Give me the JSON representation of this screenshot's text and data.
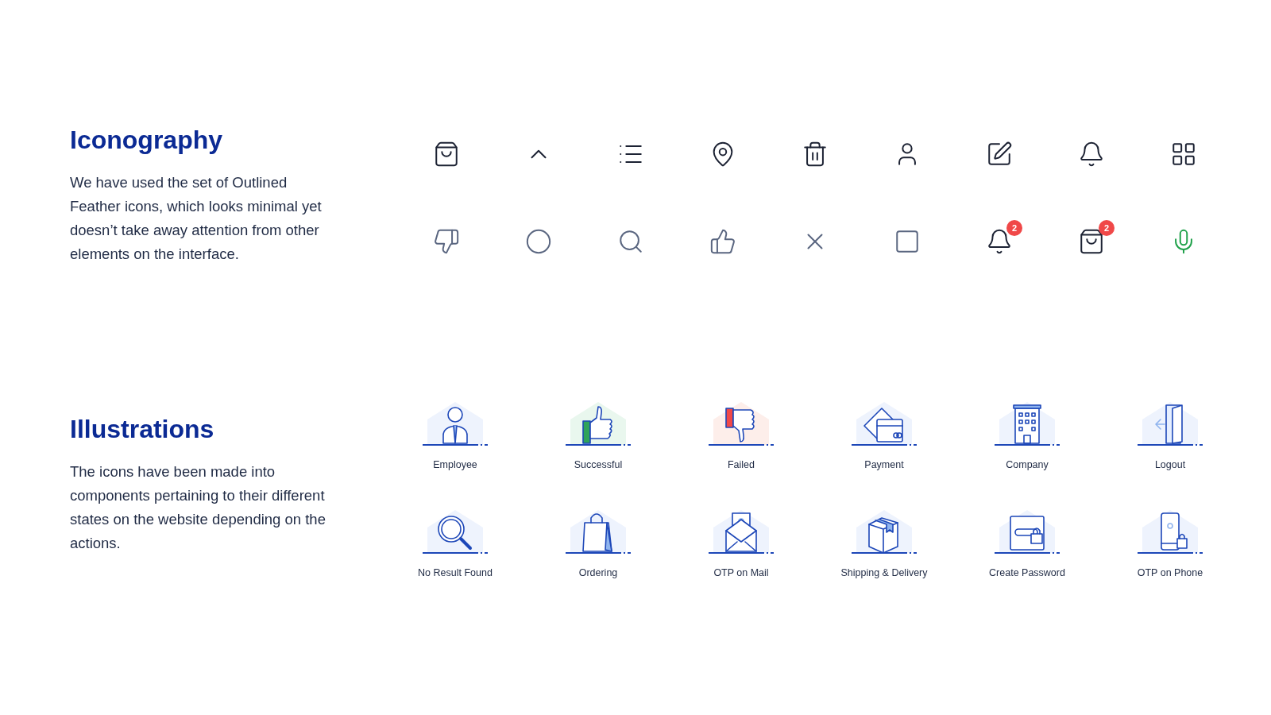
{
  "iconography": {
    "title": "Iconography",
    "description": "We have used the set of Outlined Feather icons, which looks minimal yet doesn’t take away attention from other elements on the interface.",
    "icon_rows": [
      [
        {
          "kind": "bag",
          "color": "#1c2233"
        },
        {
          "kind": "chevron-up",
          "color": "#1c2233"
        },
        {
          "kind": "list",
          "color": "#1c2233"
        },
        {
          "kind": "pin",
          "color": "#1c2233"
        },
        {
          "kind": "trash",
          "color": "#1c2233"
        },
        {
          "kind": "user",
          "color": "#1c2233"
        },
        {
          "kind": "edit",
          "color": "#1c2233"
        },
        {
          "kind": "bell",
          "color": "#1c2233"
        },
        {
          "kind": "grid",
          "color": "#1c2233"
        }
      ],
      [
        {
          "kind": "thumbs-down",
          "color": "#5a6680"
        },
        {
          "kind": "circle",
          "color": "#5a6680"
        },
        {
          "kind": "search",
          "color": "#5a6680"
        },
        {
          "kind": "thumbs-up",
          "color": "#5a6680"
        },
        {
          "kind": "close",
          "color": "#5a6680"
        },
        {
          "kind": "square",
          "color": "#5a6680"
        },
        {
          "kind": "bell",
          "color": "#1c2233",
          "badge": "2"
        },
        {
          "kind": "bag",
          "color": "#1c2233",
          "badge": "2"
        },
        {
          "kind": "mic",
          "color": "#1fa14a"
        }
      ]
    ]
  },
  "illustrations": {
    "title": "Illustrations",
    "description": "The icons have been made into components pertaining to their different states on the website depending on the actions.",
    "items": [
      {
        "kind": "employee",
        "label": "Employee"
      },
      {
        "kind": "successful",
        "label": "Successful"
      },
      {
        "kind": "failed",
        "label": "Failed"
      },
      {
        "kind": "payment",
        "label": "Payment"
      },
      {
        "kind": "company",
        "label": "Company"
      },
      {
        "kind": "logout",
        "label": "Logout"
      },
      {
        "kind": "no-result",
        "label": "No Result Found"
      },
      {
        "kind": "ordering",
        "label": "Ordering"
      },
      {
        "kind": "otp-mail",
        "label": "OTP on Mail"
      },
      {
        "kind": "shipping",
        "label": "Shipping & Delivery"
      },
      {
        "kind": "password",
        "label": "Create Password"
      },
      {
        "kind": "otp-phone",
        "label": "OTP on Phone"
      }
    ]
  }
}
